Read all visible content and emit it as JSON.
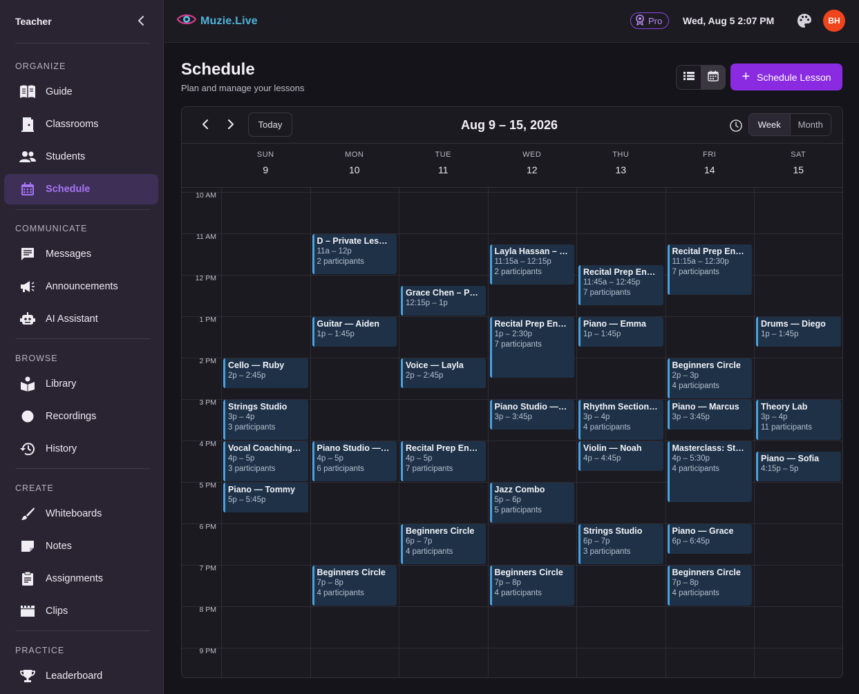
{
  "sidebar": {
    "title": "Teacher",
    "sections": {
      "organize": "ORGANIZE",
      "communicate": "COMMUNICATE",
      "browse": "BROWSE",
      "create": "CREATE",
      "practice": "PRACTICE"
    },
    "items": {
      "guide": "Guide",
      "classrooms": "Classrooms",
      "students": "Students",
      "schedule": "Schedule",
      "messages": "Messages",
      "announcements": "Announcements",
      "ai_assistant": "AI Assistant",
      "library": "Library",
      "recordings": "Recordings",
      "history": "History",
      "whiteboards": "Whiteboards",
      "notes": "Notes",
      "assignments": "Assignments",
      "clips": "Clips",
      "leaderboard": "Leaderboard"
    },
    "active_item": "Schedule"
  },
  "topbar": {
    "logo_text": "Muzie.Live",
    "pro_label": "Pro",
    "datetime": "Wed, Aug 5 2:07 PM",
    "avatar_initials": "BH"
  },
  "page": {
    "title": "Schedule",
    "subtitle": "Plan and manage your lessons",
    "schedule_button": "Schedule Lesson"
  },
  "calendar": {
    "today_label": "Today",
    "range_title": "Aug 9 – 15, 2026",
    "view_week": "Week",
    "view_month": "Month",
    "active_view": "Week",
    "days": [
      {
        "dow": "SUN",
        "num": "9"
      },
      {
        "dow": "MON",
        "num": "10"
      },
      {
        "dow": "TUE",
        "num": "11"
      },
      {
        "dow": "WED",
        "num": "12"
      },
      {
        "dow": "THU",
        "num": "13"
      },
      {
        "dow": "FRI",
        "num": "14"
      },
      {
        "dow": "SAT",
        "num": "15"
      }
    ],
    "hours": [
      "10 AM",
      "11 AM",
      "12 PM",
      "1 PM",
      "2 PM",
      "3 PM",
      "4 PM",
      "5 PM",
      "6 PM",
      "7 PM",
      "8 PM",
      "9 PM"
    ],
    "events": [
      {
        "day": 0,
        "start": 14,
        "end": 14.75,
        "title": "Cello — Ruby",
        "time": "2p – 2:45p",
        "participants": ""
      },
      {
        "day": 0,
        "start": 15,
        "end": 16,
        "title": "Strings Studio",
        "time": "3p – 4p",
        "participants": "3 participants"
      },
      {
        "day": 0,
        "start": 16,
        "end": 17,
        "title": "Vocal Coaching…",
        "time": "4p – 5p",
        "participants": "3 participants"
      },
      {
        "day": 0,
        "start": 17,
        "end": 17.75,
        "title": "Piano — Tommy",
        "time": "5p – 5:45p",
        "participants": ""
      },
      {
        "day": 1,
        "start": 11,
        "end": 12,
        "title": "D – Private Les…",
        "time": "11a – 12p",
        "participants": "2 participants"
      },
      {
        "day": 1,
        "start": 13,
        "end": 13.75,
        "title": "Guitar — Aiden",
        "time": "1p – 1:45p",
        "participants": ""
      },
      {
        "day": 1,
        "start": 16,
        "end": 17,
        "title": "Piano Studio —…",
        "time": "4p – 5p",
        "participants": "6 participants"
      },
      {
        "day": 1,
        "start": 19,
        "end": 20,
        "title": "Beginners Circle",
        "time": "7p – 8p",
        "participants": "4 participants"
      },
      {
        "day": 2,
        "start": 12.25,
        "end": 13,
        "title": "Grace Chen – P…",
        "time": "12:15p – 1p",
        "participants": ""
      },
      {
        "day": 2,
        "start": 14,
        "end": 14.75,
        "title": "Voice — Layla",
        "time": "2p – 2:45p",
        "participants": ""
      },
      {
        "day": 2,
        "start": 16,
        "end": 17,
        "title": "Recital Prep En…",
        "time": "4p – 5p",
        "participants": "7 participants"
      },
      {
        "day": 2,
        "start": 18,
        "end": 19,
        "title": "Beginners Circle",
        "time": "6p – 7p",
        "participants": "4 participants"
      },
      {
        "day": 3,
        "start": 11.25,
        "end": 12.25,
        "title": "Layla Hassan – …",
        "time": "11:15a – 12:15p",
        "participants": "2 participants"
      },
      {
        "day": 3,
        "start": 13,
        "end": 14.5,
        "title": "Recital Prep En…",
        "time": "1p – 2:30p",
        "participants": "7 participants"
      },
      {
        "day": 3,
        "start": 15,
        "end": 15.75,
        "title": "Piano Studio —…",
        "time": "3p – 3:45p",
        "participants": ""
      },
      {
        "day": 3,
        "start": 17,
        "end": 18,
        "title": "Jazz Combo",
        "time": "5p – 6p",
        "participants": "5 participants"
      },
      {
        "day": 3,
        "start": 19,
        "end": 20,
        "title": "Beginners Circle",
        "time": "7p – 8p",
        "participants": "4 participants"
      },
      {
        "day": 4,
        "start": 11.75,
        "end": 12.75,
        "title": "Recital Prep En…",
        "time": "11:45a – 12:45p",
        "participants": "7 participants"
      },
      {
        "day": 4,
        "start": 13,
        "end": 13.75,
        "title": "Piano — Emma",
        "time": "1p – 1:45p",
        "participants": ""
      },
      {
        "day": 4,
        "start": 15,
        "end": 16,
        "title": "Rhythm Section…",
        "time": "3p – 4p",
        "participants": "4 participants"
      },
      {
        "day": 4,
        "start": 16,
        "end": 16.75,
        "title": "Violin — Noah",
        "time": "4p – 4:45p",
        "participants": ""
      },
      {
        "day": 4,
        "start": 18,
        "end": 19,
        "title": "Strings Studio",
        "time": "6p – 7p",
        "participants": "3 participants"
      },
      {
        "day": 5,
        "start": 11.25,
        "end": 12.5,
        "title": "Recital Prep En…",
        "time": "11:15a – 12:30p",
        "participants": "7 participants"
      },
      {
        "day": 5,
        "start": 14,
        "end": 15,
        "title": "Beginners Circle",
        "time": "2p – 3p",
        "participants": "4 participants"
      },
      {
        "day": 5,
        "start": 15,
        "end": 15.75,
        "title": "Piano — Marcus",
        "time": "3p – 3:45p",
        "participants": ""
      },
      {
        "day": 5,
        "start": 16,
        "end": 17.5,
        "title": "Masterclass: St…",
        "time": "4p – 5:30p",
        "participants": "4 participants"
      },
      {
        "day": 5,
        "start": 18,
        "end": 18.75,
        "title": "Piano — Grace",
        "time": "6p – 6:45p",
        "participants": ""
      },
      {
        "day": 5,
        "start": 19,
        "end": 20,
        "title": "Beginners Circle",
        "time": "7p – 8p",
        "participants": "4 participants"
      },
      {
        "day": 6,
        "start": 13,
        "end": 13.75,
        "title": "Drums — Diego",
        "time": "1p – 1:45p",
        "participants": ""
      },
      {
        "day": 6,
        "start": 15,
        "end": 16,
        "title": "Theory Lab",
        "time": "3p – 4p",
        "participants": "11 participants"
      },
      {
        "day": 6,
        "start": 16.25,
        "end": 17,
        "title": "Piano — Sofia",
        "time": "4:15p – 5p",
        "participants": ""
      }
    ]
  },
  "colors": {
    "accent": "#8a2be2",
    "active_nav_text": "#a774f5",
    "event_bg": "#1e3147",
    "event_border": "#4aa3e0",
    "avatar_bg": "#f0451c"
  }
}
